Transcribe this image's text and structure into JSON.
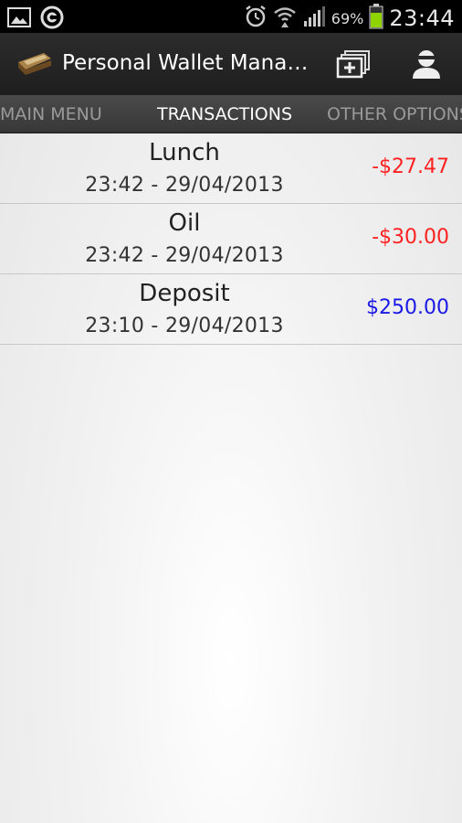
{
  "status_bar": {
    "battery_percent": "69%",
    "time": "23:44",
    "icons": [
      "gallery-icon",
      "sync-icon",
      "alarm-icon",
      "wifi-icon",
      "signal-icon",
      "battery-icon"
    ]
  },
  "app_bar": {
    "title": "Personal Wallet Mana…",
    "icons": [
      "wallet-icon",
      "add-account-icon",
      "profile-icon"
    ]
  },
  "tabs": [
    {
      "label": "MAIN MENU",
      "active": false
    },
    {
      "label": "TRANSACTIONS",
      "active": true
    },
    {
      "label": "OTHER OPTIONS",
      "active": false
    }
  ],
  "transactions": [
    {
      "name": "Lunch",
      "datetime": "23:42 - 29/04/2013",
      "amount": "-$27.47",
      "color": "#ff2222"
    },
    {
      "name": "Oil",
      "datetime": "23:42 - 29/04/2013",
      "amount": "-$30.00",
      "color": "#ff2222"
    },
    {
      "name": "Deposit",
      "datetime": "23:10 - 29/04/2013",
      "amount": "$250.00",
      "color": "#1a1ae6"
    }
  ],
  "colors": {
    "debit": "#ff2222",
    "credit": "#1a1ae6",
    "battery": "#8fd400"
  }
}
